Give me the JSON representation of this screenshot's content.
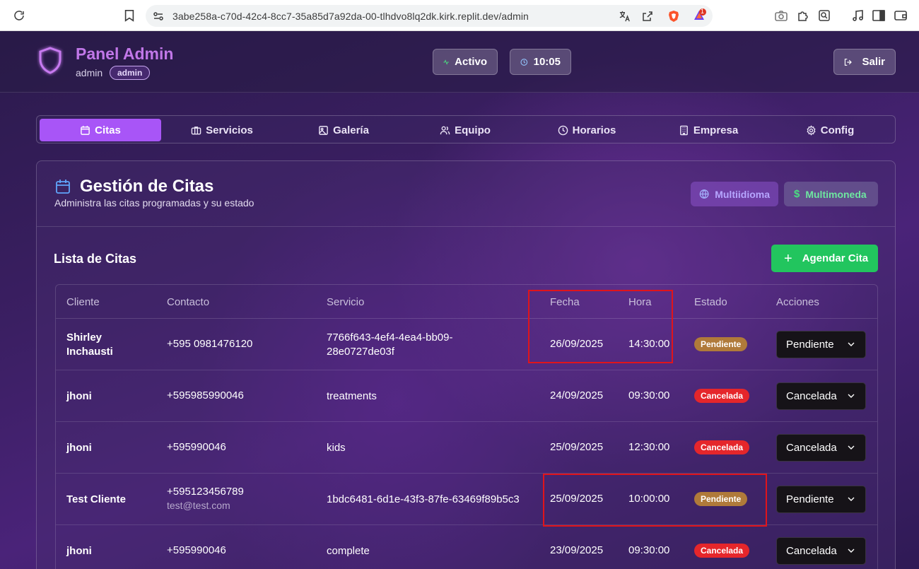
{
  "browser": {
    "url": "3abe258a-c70d-42c4-8cc7-35a85d7a92da-00-tlhdvo8lq2dk.kirk.replit.dev/admin",
    "brave_badge": "1"
  },
  "header": {
    "title": "Panel Admin",
    "user": "admin",
    "role_badge": "admin",
    "status_label": "Activo",
    "time_label": "10:05",
    "logout_label": "Salir"
  },
  "tabs": [
    {
      "label": "Citas",
      "icon": "calendar-icon",
      "active": true
    },
    {
      "label": "Servicios",
      "icon": "briefcase-icon"
    },
    {
      "label": "Galería",
      "icon": "image-icon"
    },
    {
      "label": "Equipo",
      "icon": "users-icon"
    },
    {
      "label": "Horarios",
      "icon": "clock-icon"
    },
    {
      "label": "Empresa",
      "icon": "building-icon"
    },
    {
      "label": "Config",
      "icon": "gear-icon"
    }
  ],
  "panel": {
    "title": "Gestión de Citas",
    "subtitle": "Administra las citas programadas y su estado",
    "multilang_label": "Multiidioma",
    "multicurrency_label": "Multimoneda",
    "list_title": "Lista de Citas",
    "add_label": "Agendar Cita"
  },
  "table": {
    "columns": [
      "Cliente",
      "Contacto",
      "Servicio",
      "Fecha",
      "Hora",
      "Estado",
      "Acciones"
    ],
    "rows": [
      {
        "cliente": "Shirley\nInchausti",
        "contacto": "+595 0981476120",
        "email": "",
        "servicio": "7766f643-4ef4-4ea4-bb09-\n28e0727de03f",
        "fecha": "26/09/2025",
        "hora": "14:30:00",
        "estado": "Pendiente",
        "accion": "Pendiente"
      },
      {
        "cliente": "jhoni",
        "contacto": "+595985990046",
        "email": "",
        "servicio": "treatments",
        "fecha": "24/09/2025",
        "hora": "09:30:00",
        "estado": "Cancelada",
        "accion": "Cancelada"
      },
      {
        "cliente": "jhoni",
        "contacto": "+595990046",
        "email": "",
        "servicio": "kids",
        "fecha": "25/09/2025",
        "hora": "12:30:00",
        "estado": "Cancelada",
        "accion": "Cancelada"
      },
      {
        "cliente": "Test Cliente",
        "contacto": "+595123456789",
        "email": "test@test.com",
        "servicio": "1bdc6481-6d1e-43f3-87fe-63469f89b5c3",
        "fecha": "25/09/2025",
        "hora": "10:00:00",
        "estado": "Pendiente",
        "accion": "Pendiente"
      },
      {
        "cliente": "jhoni",
        "contacto": "+595990046",
        "email": "",
        "servicio": "complete",
        "fecha": "23/09/2025",
        "hora": "09:30:00",
        "estado": "Cancelada",
        "accion": "Cancelada"
      }
    ]
  },
  "colors": {
    "accent": "#a855f7",
    "success": "#22c55e",
    "pending": "#b07a3a",
    "cancelled": "#e5262b",
    "highlight": "#e0141b"
  }
}
